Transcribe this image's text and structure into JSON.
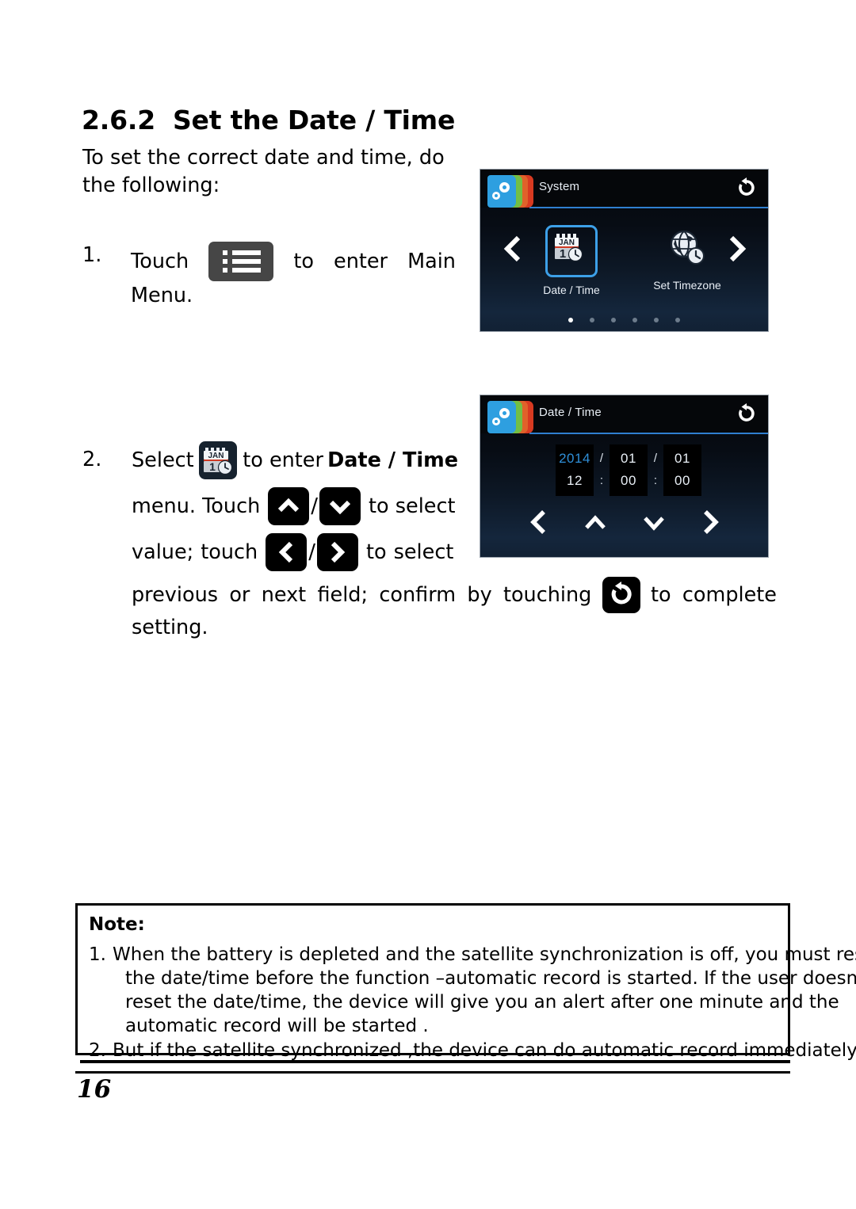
{
  "document": {
    "heading_number": "2.6.2",
    "heading_title": "Set the Date / Time",
    "intro": "To set the correct date and time, do the following:",
    "page_number": "16"
  },
  "steps": {
    "step1": {
      "marker": "1.",
      "before_icon": "Touch",
      "icon": "main-menu-list-icon",
      "after_icon_a": "to",
      "after_icon_b": "enter",
      "after_icon_c": "Main",
      "line2": "Menu."
    },
    "step2": {
      "marker": "2.",
      "l1_a": "Select",
      "l1_icon": "date-time-calendar-icon",
      "l1_b": "to enter",
      "l1_bold": "Date / Time",
      "l2_a": "menu. Touch",
      "l2_icon_up": "chevron-up-icon",
      "l2_slash": "/",
      "l2_icon_down": "chevron-down-icon",
      "l2_b": "to select",
      "l3_a": "value;",
      "l3_a2": "touch",
      "l3_icon_left": "chevron-left-icon",
      "l3_slash": "/",
      "l3_icon_right": "chevron-right-icon",
      "l3_b": "to",
      "l3_b2": "select",
      "l4_a": "previous",
      "l4_b": "or",
      "l4_c": "next",
      "l4_d": "field;",
      "l4_e": "confirm",
      "l4_f": "by",
      "l4_g": "touching",
      "l4_icon": "confirm-refresh-icon",
      "l4_h": "to",
      "l4_i": "complete",
      "l5": "setting."
    }
  },
  "device_screen_system": {
    "title": "System",
    "refresh_icon": "refresh-icon",
    "prev_icon": "chevron-left-icon",
    "next_icon": "chevron-right-icon",
    "items": [
      {
        "label": "Date / Time",
        "icon": "calendar-clock-icon",
        "selected": true
      },
      {
        "label": "Set Timezone",
        "icon": "globe-clock-icon",
        "selected": false
      }
    ],
    "calendar_icon": {
      "month": "JAN",
      "day": "1"
    },
    "page_dots": {
      "count": 6,
      "active_index": 0
    }
  },
  "device_screen_datetime": {
    "title": "Date / Time",
    "refresh_icon": "refresh-icon",
    "fields": {
      "year": "2014",
      "month": "01",
      "day": "01",
      "hour": "12",
      "minute": "00",
      "second": "00",
      "date_separator": "/",
      "time_separator": ":",
      "selected_field": "year"
    },
    "nav_icons": [
      "chevron-left-icon",
      "chevron-up-icon",
      "chevron-down-icon",
      "chevron-right-icon"
    ]
  },
  "note": {
    "title": "Note:",
    "items": [
      {
        "marker": "1.",
        "lines": [
          "When the battery is depleted and the satellite synchronization is off, you must reset",
          "the date/time before the function –automatic record is started. If the user doesn't",
          "reset the date/time, the device will give you an alert after one minute and the",
          "automatic record will be started ."
        ]
      },
      {
        "marker": "2.",
        "lines": [
          "But if the satellite synchronized ,the device can do automatic record immediately."
        ]
      }
    ]
  },
  "colors": {
    "accent_blue": "#2f8fd8",
    "device_bg": "#0a121d",
    "tab_blue": "#2e9fe0",
    "tab_green": "#72bf44",
    "tab_orange": "#e0622a",
    "tab_red": "#d83a21",
    "button_dark": "#464646"
  }
}
